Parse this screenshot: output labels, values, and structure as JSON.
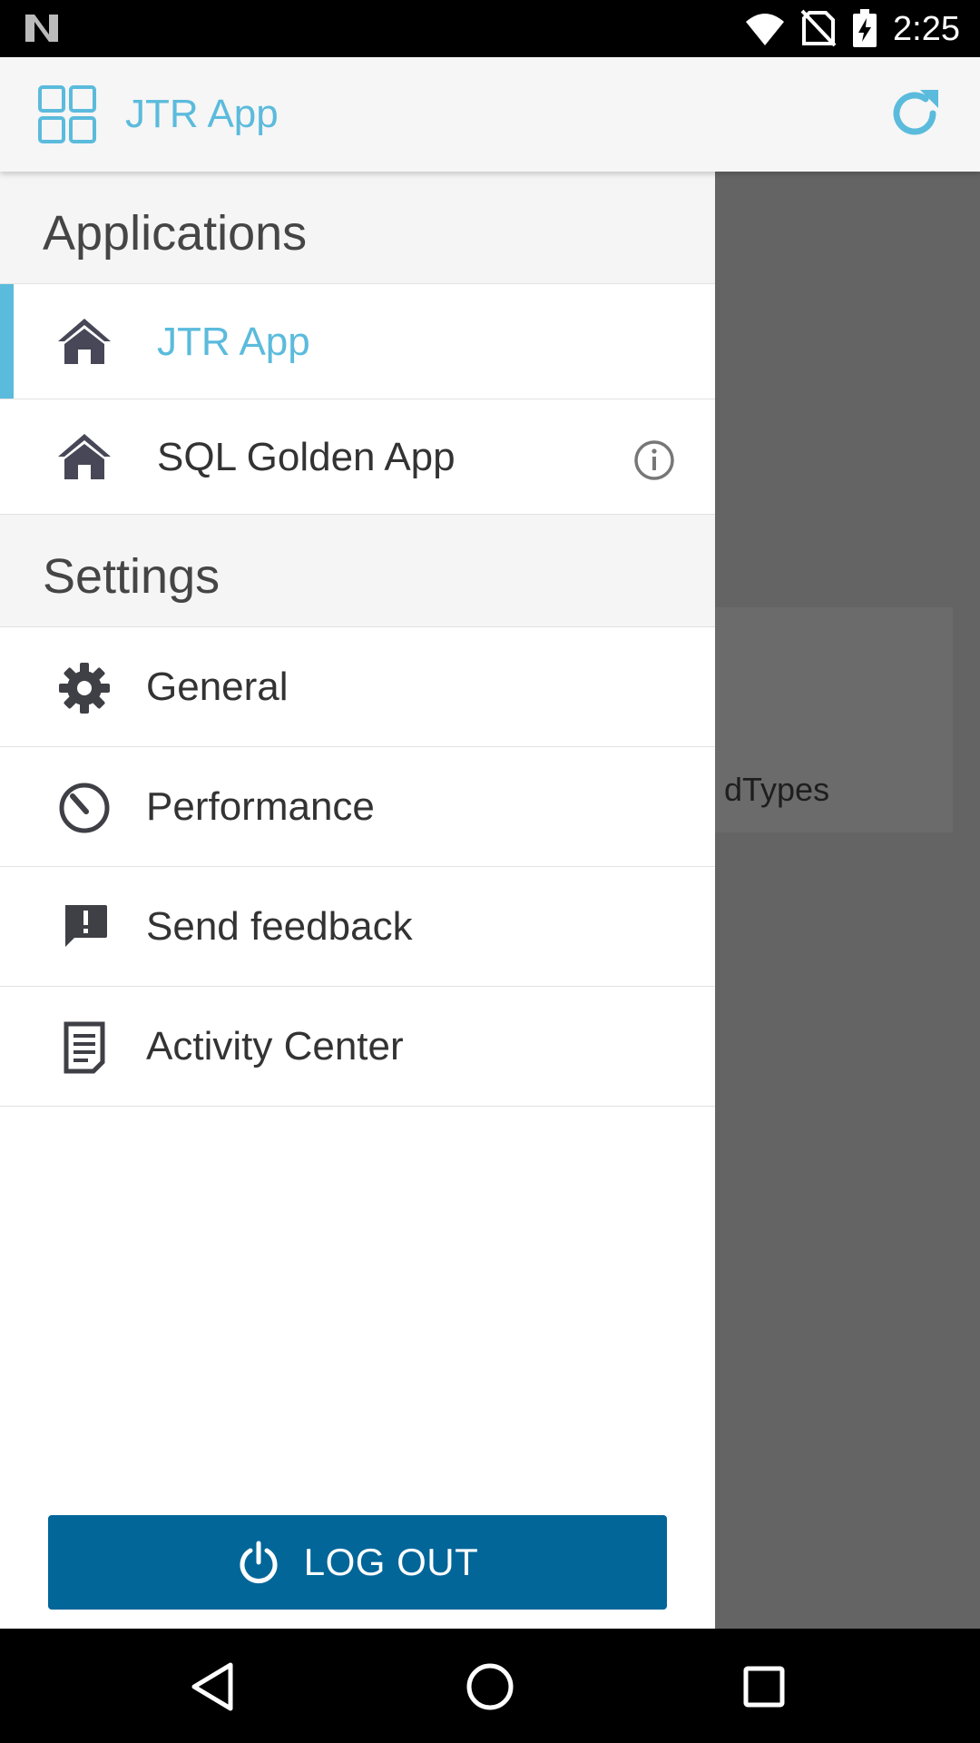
{
  "status_bar": {
    "time": "2:25"
  },
  "toolbar": {
    "title": "JTR App",
    "accent_color": "#5bbbdc",
    "left_icon": "app-grid-icon",
    "right_icon": "refresh-icon"
  },
  "background": {
    "partial_text": "l dTypes"
  },
  "drawer": {
    "applications_header": "Applications",
    "applications": [
      {
        "label": "JTR App",
        "icon": "home-icon",
        "active": true
      },
      {
        "label": "SQL Golden App",
        "icon": "home-icon",
        "active": false,
        "has_info": true
      }
    ],
    "settings_header": "Settings",
    "settings": [
      {
        "label": "General",
        "icon": "gear-icon"
      },
      {
        "label": "Performance",
        "icon": "gauge-icon"
      },
      {
        "label": "Send feedback",
        "icon": "feedback-icon"
      },
      {
        "label": "Activity Center",
        "icon": "document-icon"
      }
    ],
    "logout_label": "LOG OUT",
    "logout_color": "#026699"
  },
  "nav_bar": {
    "buttons": [
      "back-icon",
      "home-circle-icon",
      "recents-icon"
    ]
  }
}
